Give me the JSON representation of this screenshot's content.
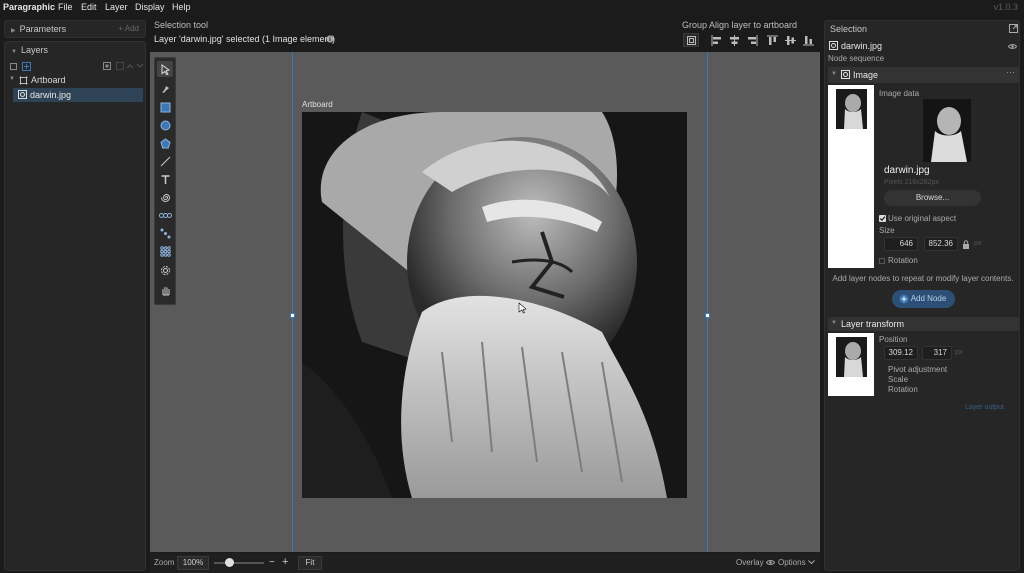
{
  "menu": {
    "items": [
      "Paragraphic",
      "File",
      "Edit",
      "Layer",
      "Display",
      "Help"
    ],
    "version": "v1.0.3"
  },
  "left": {
    "parameters": {
      "title": "Parameters",
      "add_label": "+ Add"
    },
    "layers": {
      "title": "Layers",
      "tree": [
        {
          "label": "Artboard"
        },
        {
          "label": "darwin.jpg"
        }
      ]
    }
  },
  "toolbar": {
    "tool_name": "Selection tool",
    "status": "Layer 'darwin.jpg' selected (1 Image element)",
    "group_label": "Group",
    "align_label": "Align layer to artboard"
  },
  "tools": [
    "select-icon",
    "pen-icon",
    "rectangle-icon",
    "ellipse-icon",
    "polygon-icon",
    "line-icon",
    "text-icon",
    "spiral-icon",
    "repeat-icon",
    "node-path-icon",
    "grid-icon",
    "gear-icon",
    "hand-icon"
  ],
  "canvas": {
    "artboard_label": "Artboard"
  },
  "bottom": {
    "zoom_label": "Zoom",
    "zoom_value": "100%",
    "zoom_level": 0.3,
    "minus": "−",
    "plus": "+",
    "fit_label": "Fit",
    "overlay_label": "Overlay",
    "options_label": "Options"
  },
  "right": {
    "title": "Selection",
    "node_name": "darwin.jpg",
    "node_sequence": "Node sequence",
    "image_node": {
      "title": "Image",
      "data_label": "Image data",
      "filename": "darwin.jpg",
      "pixels": "Pixels 216x282px",
      "browse": "Browse...",
      "use_original": "Use original aspect",
      "size_label": "Size",
      "width": "646",
      "height": "852.36",
      "unit": "px",
      "rotation": "Rotation"
    },
    "hint": "Add layer nodes to repeat or modify layer contents.",
    "add_node": "Add Node",
    "transform": {
      "title": "Layer transform",
      "position_label": "Position",
      "x": "309.12",
      "y": "317",
      "unit": "px",
      "pivot": "Pivot adjustment",
      "scale": "Scale",
      "rotation": "Rotation"
    },
    "layer_output": "Layer output"
  },
  "colors": {
    "accent": "#3b78b4",
    "canvas": "#5a5a5a",
    "panel": "#262626",
    "add_node_bg": "#2d4e75"
  }
}
